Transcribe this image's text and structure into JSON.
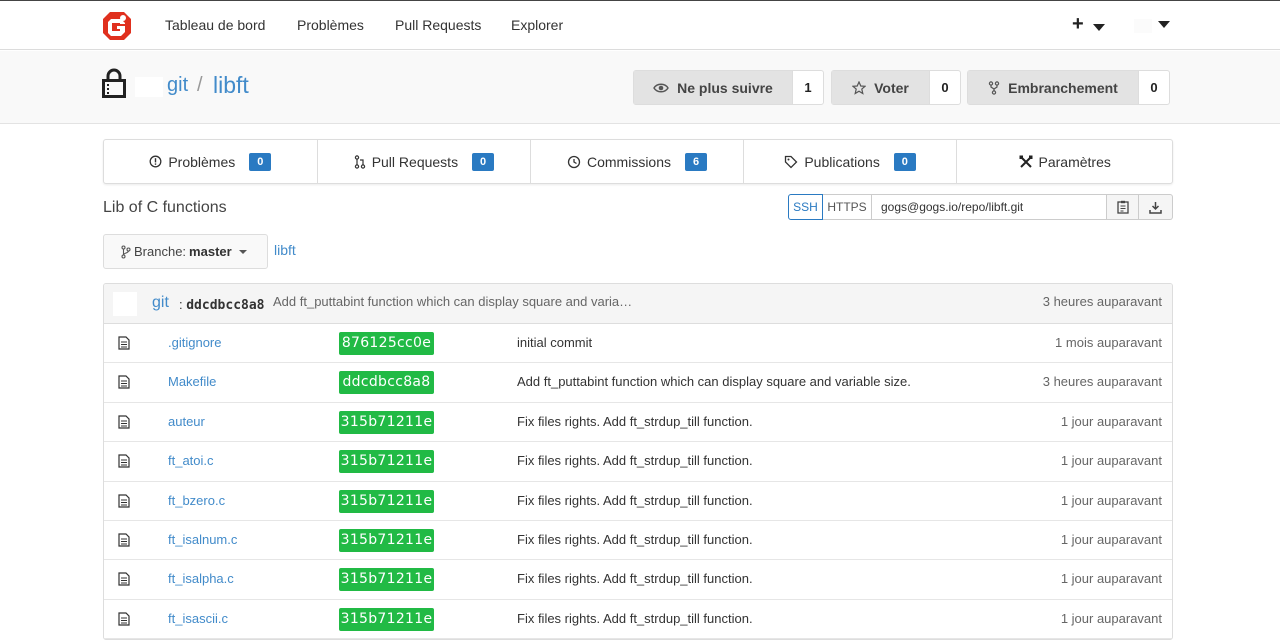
{
  "nav": {
    "items": [
      "Tableau de bord",
      "Problèmes",
      "Pull Requests",
      "Explorer"
    ],
    "plus": "+"
  },
  "repo": {
    "owner": "git",
    "separator": "/",
    "name": "libft",
    "description": "Lib of C functions"
  },
  "actions": [
    {
      "label": "Ne plus suivre",
      "count": "1",
      "icon": "eye-icon"
    },
    {
      "label": "Voter",
      "count": "0",
      "icon": "star-icon"
    },
    {
      "label": "Embranchement",
      "count": "0",
      "icon": "fork-icon"
    }
  ],
  "tabs": [
    {
      "label": "Problèmes",
      "badge": "0",
      "icon": "issue-icon"
    },
    {
      "label": "Pull Requests",
      "badge": "0",
      "icon": "pull-request-icon"
    },
    {
      "label": "Commissions",
      "badge": "6",
      "icon": "commit-icon"
    },
    {
      "label": "Publications",
      "badge": "0",
      "icon": "tag-icon"
    },
    {
      "label": "Paramètres",
      "icon": "tools-icon"
    }
  ],
  "clone": {
    "ssh": "SSH",
    "https": "HTTPS",
    "url": "gogs@gogs.io/repo/libft.git"
  },
  "branch": {
    "prefix": "Branche:",
    "name": "master",
    "breadcrumb": "libft"
  },
  "latest_commit": {
    "author": "git",
    "sha": "ddcdbcc8a8",
    "message": "Add ft_puttabint function which can display square and varia…",
    "time": "3 heures auparavant"
  },
  "files": [
    {
      "name": ".gitignore",
      "sha": "876125cc0e",
      "message": "initial commit",
      "time": "1 mois auparavant"
    },
    {
      "name": "Makefile",
      "sha": "ddcdbcc8a8",
      "message": "Add ft_puttabint function which can display square and variable size.",
      "time": "3 heures auparavant"
    },
    {
      "name": "auteur",
      "sha": "315b71211e",
      "message": "Fix files rights. Add ft_strdup_till function.",
      "time": "1 jour auparavant"
    },
    {
      "name": "ft_atoi.c",
      "sha": "315b71211e",
      "message": "Fix files rights. Add ft_strdup_till function.",
      "time": "1 jour auparavant"
    },
    {
      "name": "ft_bzero.c",
      "sha": "315b71211e",
      "message": "Fix files rights. Add ft_strdup_till function.",
      "time": "1 jour auparavant"
    },
    {
      "name": "ft_isalnum.c",
      "sha": "315b71211e",
      "message": "Fix files rights. Add ft_strdup_till function.",
      "time": "1 jour auparavant"
    },
    {
      "name": "ft_isalpha.c",
      "sha": "315b71211e",
      "message": "Fix files rights. Add ft_strdup_till function.",
      "time": "1 jour auparavant"
    },
    {
      "name": "ft_isascii.c",
      "sha": "315b71211e",
      "message": "Fix files rights. Add ft_strdup_till function.",
      "time": "1 jour auparavant"
    }
  ],
  "colors": {
    "link": "#428bca",
    "sha_badge": "#21ba45",
    "count_badge": "#2a7ac2",
    "logo": "#e0301e"
  }
}
